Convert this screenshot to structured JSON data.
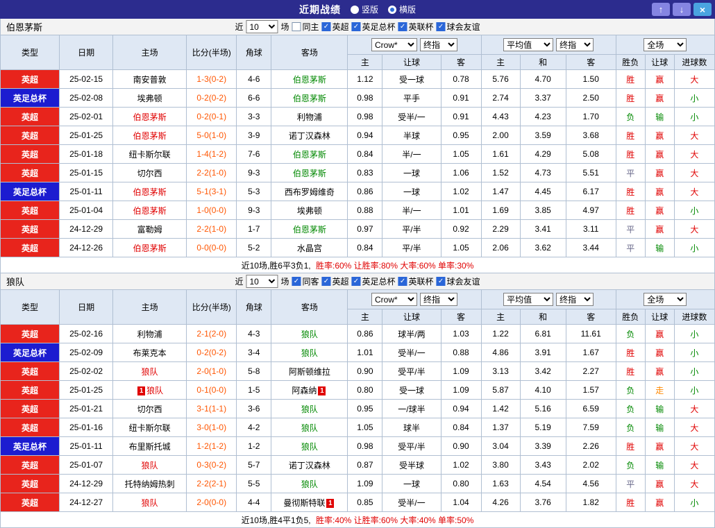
{
  "titlebar": {
    "title": "近期战绩",
    "vertical_label": "竖版",
    "horizontal_label": "横版",
    "vertical_selected": false,
    "horizontal_selected": true,
    "up_icon": "↑",
    "down_icon": "↓",
    "close_icon": "×"
  },
  "header": {
    "col_type": "类型",
    "col_date": "日期",
    "col_home": "主场",
    "col_score": "比分(半场)",
    "col_corner": "角球",
    "col_away": "客场",
    "dd_bookmaker": "Crow*",
    "dd_final": "终指",
    "dd_average": "平均值",
    "dd_fullmatch": "全场",
    "sub_home": "主",
    "sub_handicap": "让球",
    "sub_away": "客",
    "sub_draw": "和",
    "col_result": "胜负",
    "col_goals": "进球数"
  },
  "sections": [
    {
      "team": "伯恩茅斯",
      "filters": {
        "near_label": "近",
        "count": "10",
        "matches_label": "场",
        "same_label": "同主",
        "same_checked": false,
        "comps": [
          {
            "label": "英超",
            "checked": true
          },
          {
            "label": "英足总杯",
            "checked": true
          },
          {
            "label": "英联杯",
            "checked": true
          },
          {
            "label": "球会友谊",
            "checked": true
          }
        ]
      },
      "rows": [
        {
          "league": "英超",
          "league_color": "red",
          "date": "25-02-15",
          "home": {
            "name": "南安普敦",
            "role": "opp"
          },
          "score": "1-3(0-2)",
          "corners": "4-6",
          "away": {
            "name": "伯恩茅斯",
            "role": "self-away"
          },
          "odds": [
            "1.12",
            "受一球",
            "0.78",
            "5.76",
            "4.70",
            "1.50"
          ],
          "result": {
            "text": "胜",
            "tone": "red"
          },
          "handicap": {
            "text": "赢",
            "tone": "red"
          },
          "goals": {
            "text": "大",
            "tone": "red"
          }
        },
        {
          "league": "英足总杯",
          "league_color": "blue",
          "date": "25-02-08",
          "home": {
            "name": "埃弗顿",
            "role": "opp"
          },
          "score": "0-2(0-2)",
          "corners": "6-6",
          "away": {
            "name": "伯恩茅斯",
            "role": "self-away"
          },
          "odds": [
            "0.98",
            "平手",
            "0.91",
            "2.74",
            "3.37",
            "2.50"
          ],
          "result": {
            "text": "胜",
            "tone": "red"
          },
          "handicap": {
            "text": "赢",
            "tone": "red"
          },
          "goals": {
            "text": "小",
            "tone": "green"
          }
        },
        {
          "league": "英超",
          "league_color": "red",
          "date": "25-02-01",
          "home": {
            "name": "伯恩茅斯",
            "role": "self-home"
          },
          "score": "0-2(0-1)",
          "corners": "3-3",
          "away": {
            "name": "利物浦",
            "role": "opp"
          },
          "odds": [
            "0.98",
            "受半/一",
            "0.91",
            "4.43",
            "4.23",
            "1.70"
          ],
          "result": {
            "text": "负",
            "tone": "green"
          },
          "handicap": {
            "text": "输",
            "tone": "green"
          },
          "goals": {
            "text": "小",
            "tone": "green"
          }
        },
        {
          "league": "英超",
          "league_color": "red",
          "date": "25-01-25",
          "home": {
            "name": "伯恩茅斯",
            "role": "self-home"
          },
          "score": "5-0(1-0)",
          "corners": "3-9",
          "away": {
            "name": "诺丁汉森林",
            "role": "opp"
          },
          "odds": [
            "0.94",
            "半球",
            "0.95",
            "2.00",
            "3.59",
            "3.68"
          ],
          "result": {
            "text": "胜",
            "tone": "red"
          },
          "handicap": {
            "text": "赢",
            "tone": "red"
          },
          "goals": {
            "text": "大",
            "tone": "red"
          }
        },
        {
          "league": "英超",
          "league_color": "red",
          "date": "25-01-18",
          "home": {
            "name": "纽卡斯尔联",
            "role": "opp"
          },
          "score": "1-4(1-2)",
          "corners": "7-6",
          "away": {
            "name": "伯恩茅斯",
            "role": "self-away"
          },
          "odds": [
            "0.84",
            "半/一",
            "1.05",
            "1.61",
            "4.29",
            "5.08"
          ],
          "result": {
            "text": "胜",
            "tone": "red"
          },
          "handicap": {
            "text": "赢",
            "tone": "red"
          },
          "goals": {
            "text": "大",
            "tone": "red"
          }
        },
        {
          "league": "英超",
          "league_color": "red",
          "date": "25-01-15",
          "home": {
            "name": "切尔西",
            "role": "opp"
          },
          "score": "2-2(1-0)",
          "corners": "9-3",
          "away": {
            "name": "伯恩茅斯",
            "role": "self-away"
          },
          "odds": [
            "0.83",
            "一球",
            "1.06",
            "1.52",
            "4.73",
            "5.51"
          ],
          "result": {
            "text": "平",
            "tone": "draw"
          },
          "handicap": {
            "text": "赢",
            "tone": "red"
          },
          "goals": {
            "text": "大",
            "tone": "red"
          }
        },
        {
          "league": "英足总杯",
          "league_color": "blue",
          "date": "25-01-11",
          "home": {
            "name": "伯恩茅斯",
            "role": "self-home"
          },
          "score": "5-1(3-1)",
          "corners": "5-3",
          "away": {
            "name": "西布罗姆维奇",
            "role": "opp"
          },
          "odds": [
            "0.86",
            "一球",
            "1.02",
            "1.47",
            "4.45",
            "6.17"
          ],
          "result": {
            "text": "胜",
            "tone": "red"
          },
          "handicap": {
            "text": "赢",
            "tone": "red"
          },
          "goals": {
            "text": "大",
            "tone": "red"
          }
        },
        {
          "league": "英超",
          "league_color": "red",
          "date": "25-01-04",
          "home": {
            "name": "伯恩茅斯",
            "role": "self-home"
          },
          "score": "1-0(0-0)",
          "corners": "9-3",
          "away": {
            "name": "埃弗顿",
            "role": "opp"
          },
          "odds": [
            "0.88",
            "半/一",
            "1.01",
            "1.69",
            "3.85",
            "4.97"
          ],
          "result": {
            "text": "胜",
            "tone": "red"
          },
          "handicap": {
            "text": "赢",
            "tone": "red"
          },
          "goals": {
            "text": "小",
            "tone": "green"
          }
        },
        {
          "league": "英超",
          "league_color": "red",
          "date": "24-12-29",
          "home": {
            "name": "富勒姆",
            "role": "opp"
          },
          "score": "2-2(1-0)",
          "corners": "1-7",
          "away": {
            "name": "伯恩茅斯",
            "role": "self-away"
          },
          "odds": [
            "0.97",
            "平/半",
            "0.92",
            "2.29",
            "3.41",
            "3.11"
          ],
          "result": {
            "text": "平",
            "tone": "draw"
          },
          "handicap": {
            "text": "赢",
            "tone": "red"
          },
          "goals": {
            "text": "大",
            "tone": "red"
          }
        },
        {
          "league": "英超",
          "league_color": "red",
          "date": "24-12-26",
          "home": {
            "name": "伯恩茅斯",
            "role": "self-home"
          },
          "score": "0-0(0-0)",
          "corners": "5-2",
          "away": {
            "name": "水晶宫",
            "role": "opp"
          },
          "odds": [
            "0.84",
            "平/半",
            "1.05",
            "2.06",
            "3.62",
            "3.44"
          ],
          "result": {
            "text": "平",
            "tone": "draw"
          },
          "handicap": {
            "text": "输",
            "tone": "green"
          },
          "goals": {
            "text": "小",
            "tone": "green"
          }
        }
      ],
      "summary": {
        "prefix": "近10场,胜6平3负1,",
        "stats": "胜率:60% 让胜率:80% 大率:60% 单率:30%"
      }
    },
    {
      "team": "狼队",
      "filters": {
        "near_label": "近",
        "count": "10",
        "matches_label": "场",
        "same_label": "同客",
        "same_checked": true,
        "comps": [
          {
            "label": "英超",
            "checked": true
          },
          {
            "label": "英足总杯",
            "checked": true
          },
          {
            "label": "英联杯",
            "checked": true
          },
          {
            "label": "球会友谊",
            "checked": true
          }
        ]
      },
      "rows": [
        {
          "league": "英超",
          "league_color": "red",
          "date": "25-02-16",
          "home": {
            "name": "利物浦",
            "role": "opp"
          },
          "score": "2-1(2-0)",
          "corners": "4-3",
          "away": {
            "name": "狼队",
            "role": "self-away"
          },
          "odds": [
            "0.86",
            "球半/两",
            "1.03",
            "1.22",
            "6.81",
            "11.61"
          ],
          "result": {
            "text": "负",
            "tone": "green"
          },
          "handicap": {
            "text": "赢",
            "tone": "red"
          },
          "goals": {
            "text": "小",
            "tone": "green"
          }
        },
        {
          "league": "英足总杯",
          "league_color": "blue",
          "date": "25-02-09",
          "home": {
            "name": "布莱克本",
            "role": "opp"
          },
          "score": "0-2(0-2)",
          "corners": "3-4",
          "away": {
            "name": "狼队",
            "role": "self-away"
          },
          "odds": [
            "1.01",
            "受半/一",
            "0.88",
            "4.86",
            "3.91",
            "1.67"
          ],
          "result": {
            "text": "胜",
            "tone": "red"
          },
          "handicap": {
            "text": "赢",
            "tone": "red"
          },
          "goals": {
            "text": "小",
            "tone": "green"
          }
        },
        {
          "league": "英超",
          "league_color": "red",
          "date": "25-02-02",
          "home": {
            "name": "狼队",
            "role": "self-home"
          },
          "score": "2-0(1-0)",
          "corners": "5-8",
          "away": {
            "name": "阿斯顿维拉",
            "role": "opp"
          },
          "odds": [
            "0.90",
            "受平/半",
            "1.09",
            "3.13",
            "3.42",
            "2.27"
          ],
          "result": {
            "text": "胜",
            "tone": "red"
          },
          "handicap": {
            "text": "赢",
            "tone": "red"
          },
          "goals": {
            "text": "小",
            "tone": "green"
          }
        },
        {
          "league": "英超",
          "league_color": "red",
          "date": "25-01-25",
          "home": {
            "name": "狼队",
            "role": "self-home",
            "card_before": "1"
          },
          "score": "0-1(0-0)",
          "corners": "1-5",
          "away": {
            "name": "阿森纳",
            "role": "opp",
            "card_after": "1"
          },
          "odds": [
            "0.80",
            "受一球",
            "1.09",
            "5.87",
            "4.10",
            "1.57"
          ],
          "result": {
            "text": "负",
            "tone": "green"
          },
          "handicap": {
            "text": "走",
            "tone": "orange"
          },
          "goals": {
            "text": "小",
            "tone": "green"
          }
        },
        {
          "league": "英超",
          "league_color": "red",
          "date": "25-01-21",
          "home": {
            "name": "切尔西",
            "role": "opp"
          },
          "score": "3-1(1-1)",
          "corners": "3-6",
          "away": {
            "name": "狼队",
            "role": "self-away"
          },
          "odds": [
            "0.95",
            "一/球半",
            "0.94",
            "1.42",
            "5.16",
            "6.59"
          ],
          "result": {
            "text": "负",
            "tone": "green"
          },
          "handicap": {
            "text": "输",
            "tone": "green"
          },
          "goals": {
            "text": "大",
            "tone": "red"
          }
        },
        {
          "league": "英超",
          "league_color": "red",
          "date": "25-01-16",
          "home": {
            "name": "纽卡斯尔联",
            "role": "opp"
          },
          "score": "3-0(1-0)",
          "corners": "4-2",
          "away": {
            "name": "狼队",
            "role": "self-away"
          },
          "odds": [
            "1.05",
            "球半",
            "0.84",
            "1.37",
            "5.19",
            "7.59"
          ],
          "result": {
            "text": "负",
            "tone": "green"
          },
          "handicap": {
            "text": "输",
            "tone": "green"
          },
          "goals": {
            "text": "大",
            "tone": "red"
          }
        },
        {
          "league": "英足总杯",
          "league_color": "blue",
          "date": "25-01-11",
          "home": {
            "name": "布里斯托城",
            "role": "opp"
          },
          "score": "1-2(1-2)",
          "corners": "1-2",
          "away": {
            "name": "狼队",
            "role": "self-away"
          },
          "odds": [
            "0.98",
            "受平/半",
            "0.90",
            "3.04",
            "3.39",
            "2.26"
          ],
          "result": {
            "text": "胜",
            "tone": "red"
          },
          "handicap": {
            "text": "赢",
            "tone": "red"
          },
          "goals": {
            "text": "大",
            "tone": "red"
          }
        },
        {
          "league": "英超",
          "league_color": "red",
          "date": "25-01-07",
          "home": {
            "name": "狼队",
            "role": "self-home"
          },
          "score": "0-3(0-2)",
          "corners": "5-7",
          "away": {
            "name": "诺丁汉森林",
            "role": "opp"
          },
          "odds": [
            "0.87",
            "受半球",
            "1.02",
            "3.80",
            "3.43",
            "2.02"
          ],
          "result": {
            "text": "负",
            "tone": "green"
          },
          "handicap": {
            "text": "输",
            "tone": "green"
          },
          "goals": {
            "text": "大",
            "tone": "red"
          }
        },
        {
          "league": "英超",
          "league_color": "red",
          "date": "24-12-29",
          "home": {
            "name": "托特纳姆热刺",
            "role": "opp"
          },
          "score": "2-2(2-1)",
          "corners": "5-5",
          "away": {
            "name": "狼队",
            "role": "self-away"
          },
          "odds": [
            "1.09",
            "一球",
            "0.80",
            "1.63",
            "4.54",
            "4.56"
          ],
          "result": {
            "text": "平",
            "tone": "draw"
          },
          "handicap": {
            "text": "赢",
            "tone": "red"
          },
          "goals": {
            "text": "大",
            "tone": "red"
          }
        },
        {
          "league": "英超",
          "league_color": "red",
          "date": "24-12-27",
          "home": {
            "name": "狼队",
            "role": "self-home"
          },
          "score": "2-0(0-0)",
          "corners": "4-4",
          "away": {
            "name": "曼彻斯特联",
            "role": "opp",
            "card_after": "1"
          },
          "odds": [
            "0.85",
            "受半/一",
            "1.04",
            "4.26",
            "3.76",
            "1.82"
          ],
          "result": {
            "text": "胜",
            "tone": "red"
          },
          "handicap": {
            "text": "赢",
            "tone": "red"
          },
          "goals": {
            "text": "小",
            "tone": "green"
          }
        }
      ],
      "summary": {
        "prefix": "近10场,胜4平1负5,",
        "stats": "胜率:40% 让胜率:60% 大率:40% 单率:50%"
      }
    }
  ]
}
